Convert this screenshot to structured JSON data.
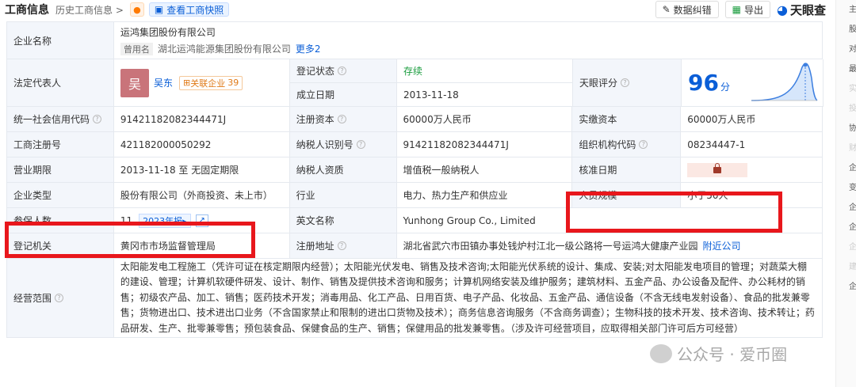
{
  "header": {
    "title": "工商信息",
    "history": "历史工商信息 >",
    "snapshot": "查看工商快照",
    "btn_data": "数据纠错",
    "btn_export": "导出",
    "logo": "天眼查"
  },
  "rows": {
    "company_name_label": "企业名称",
    "company_name": "运鸿集团股份有限公司",
    "former_tag": "曾用名",
    "former_name": "湖北运鸿能源集团股份有限公司",
    "former_more": "更多2",
    "legal_label": "法定代表人",
    "legal_avatar": "吴",
    "legal_name": "吴东",
    "assoc_label": "关联企业",
    "assoc_count": "39",
    "reg_status_label": "登记状态",
    "reg_status": "存续",
    "found_label": "成立日期",
    "found_date": "2013-11-18",
    "score_label": "天眼评分",
    "score": "96",
    "score_unit": "分",
    "credit_label": "统一社会信用代码",
    "credit_code": "91421182082344471J",
    "capital_label": "注册资本",
    "capital": "60000万人民币",
    "paid_label": "实缴资本",
    "paid": "60000万人民币",
    "biz_reg_label": "工商注册号",
    "biz_reg": "421182000050292",
    "tax_label": "纳税人识别号",
    "tax_id": "91421182082344471J",
    "org_label": "组织机构代码",
    "org_code": "08234447-1",
    "term_label": "营业期限",
    "term": "2013-11-18 至 无固定期限",
    "taxq_label": "纳税人资质",
    "taxq": "增值税一般纳税人",
    "approve_label": "核准日期",
    "type_label": "企业类型",
    "type": "股份有限公司（外商投资、未上市）",
    "industry_label": "行业",
    "industry": "电力、热力生产和供应业",
    "staff_label": "人员规模",
    "staff": "小于50人",
    "insured_label": "参保人数",
    "insured": "11",
    "year_tag": "2023年报▸",
    "en_label": "英文名称",
    "en_name": "Yunhong Group Co., Limited",
    "authority_label": "登记机关",
    "authority": "黄冈市市场监督管理局",
    "addr_label": "注册地址",
    "addr": "湖北省武穴市田镇办事处钱炉村江北一级公路将一号运鸿大健康产业园",
    "addr_link": "附近公司",
    "scope_label": "经营范围",
    "scope": "太阳能发电工程施工（凭许可证在核定期限内经营）；太阳能光伏发电、销售及技术咨询;太阳能光伏系统的设计、集成、安装;对太阳能发电项目的管理；对蔬菜大棚的建设、管理；计算机软硬件研发、设计、制作、销售及提供技术咨询和服务；计算机网络安装及维护服务；建筑材料、五金产品、办公设备及配件、办公耗材的销售；初级农产品、加工、销售；医药技术开发；消毒用品、化工产品、日用百货、电子产品、化妆品、五金产品、通信设备（不含无线电发射设备）、食品的批发兼零售；货物进出口、技术进出口业务（不含国家禁止和限制的进出口货物及技术）；商务信息咨询服务（不含商务调查）；生物科技的技术开发、技术咨询、技术转让；药品研发、生产、批零兼零售；预包装食品、保健食品的生产、销售；保健用品的批发兼零售。（涉及许可经营项目，应取得相关部门许可后方可经营）"
  },
  "side": [
    "主",
    "股",
    "对",
    "最",
    "实",
    "投",
    "协",
    "财",
    "企",
    "变",
    "企",
    "企",
    "企",
    "建",
    "企"
  ],
  "watermark": "公众号 · 爱币圈",
  "colors": {
    "highlight": "#e8171c",
    "link": "#0a5ed7",
    "label_bg": "#f3f6fb"
  }
}
